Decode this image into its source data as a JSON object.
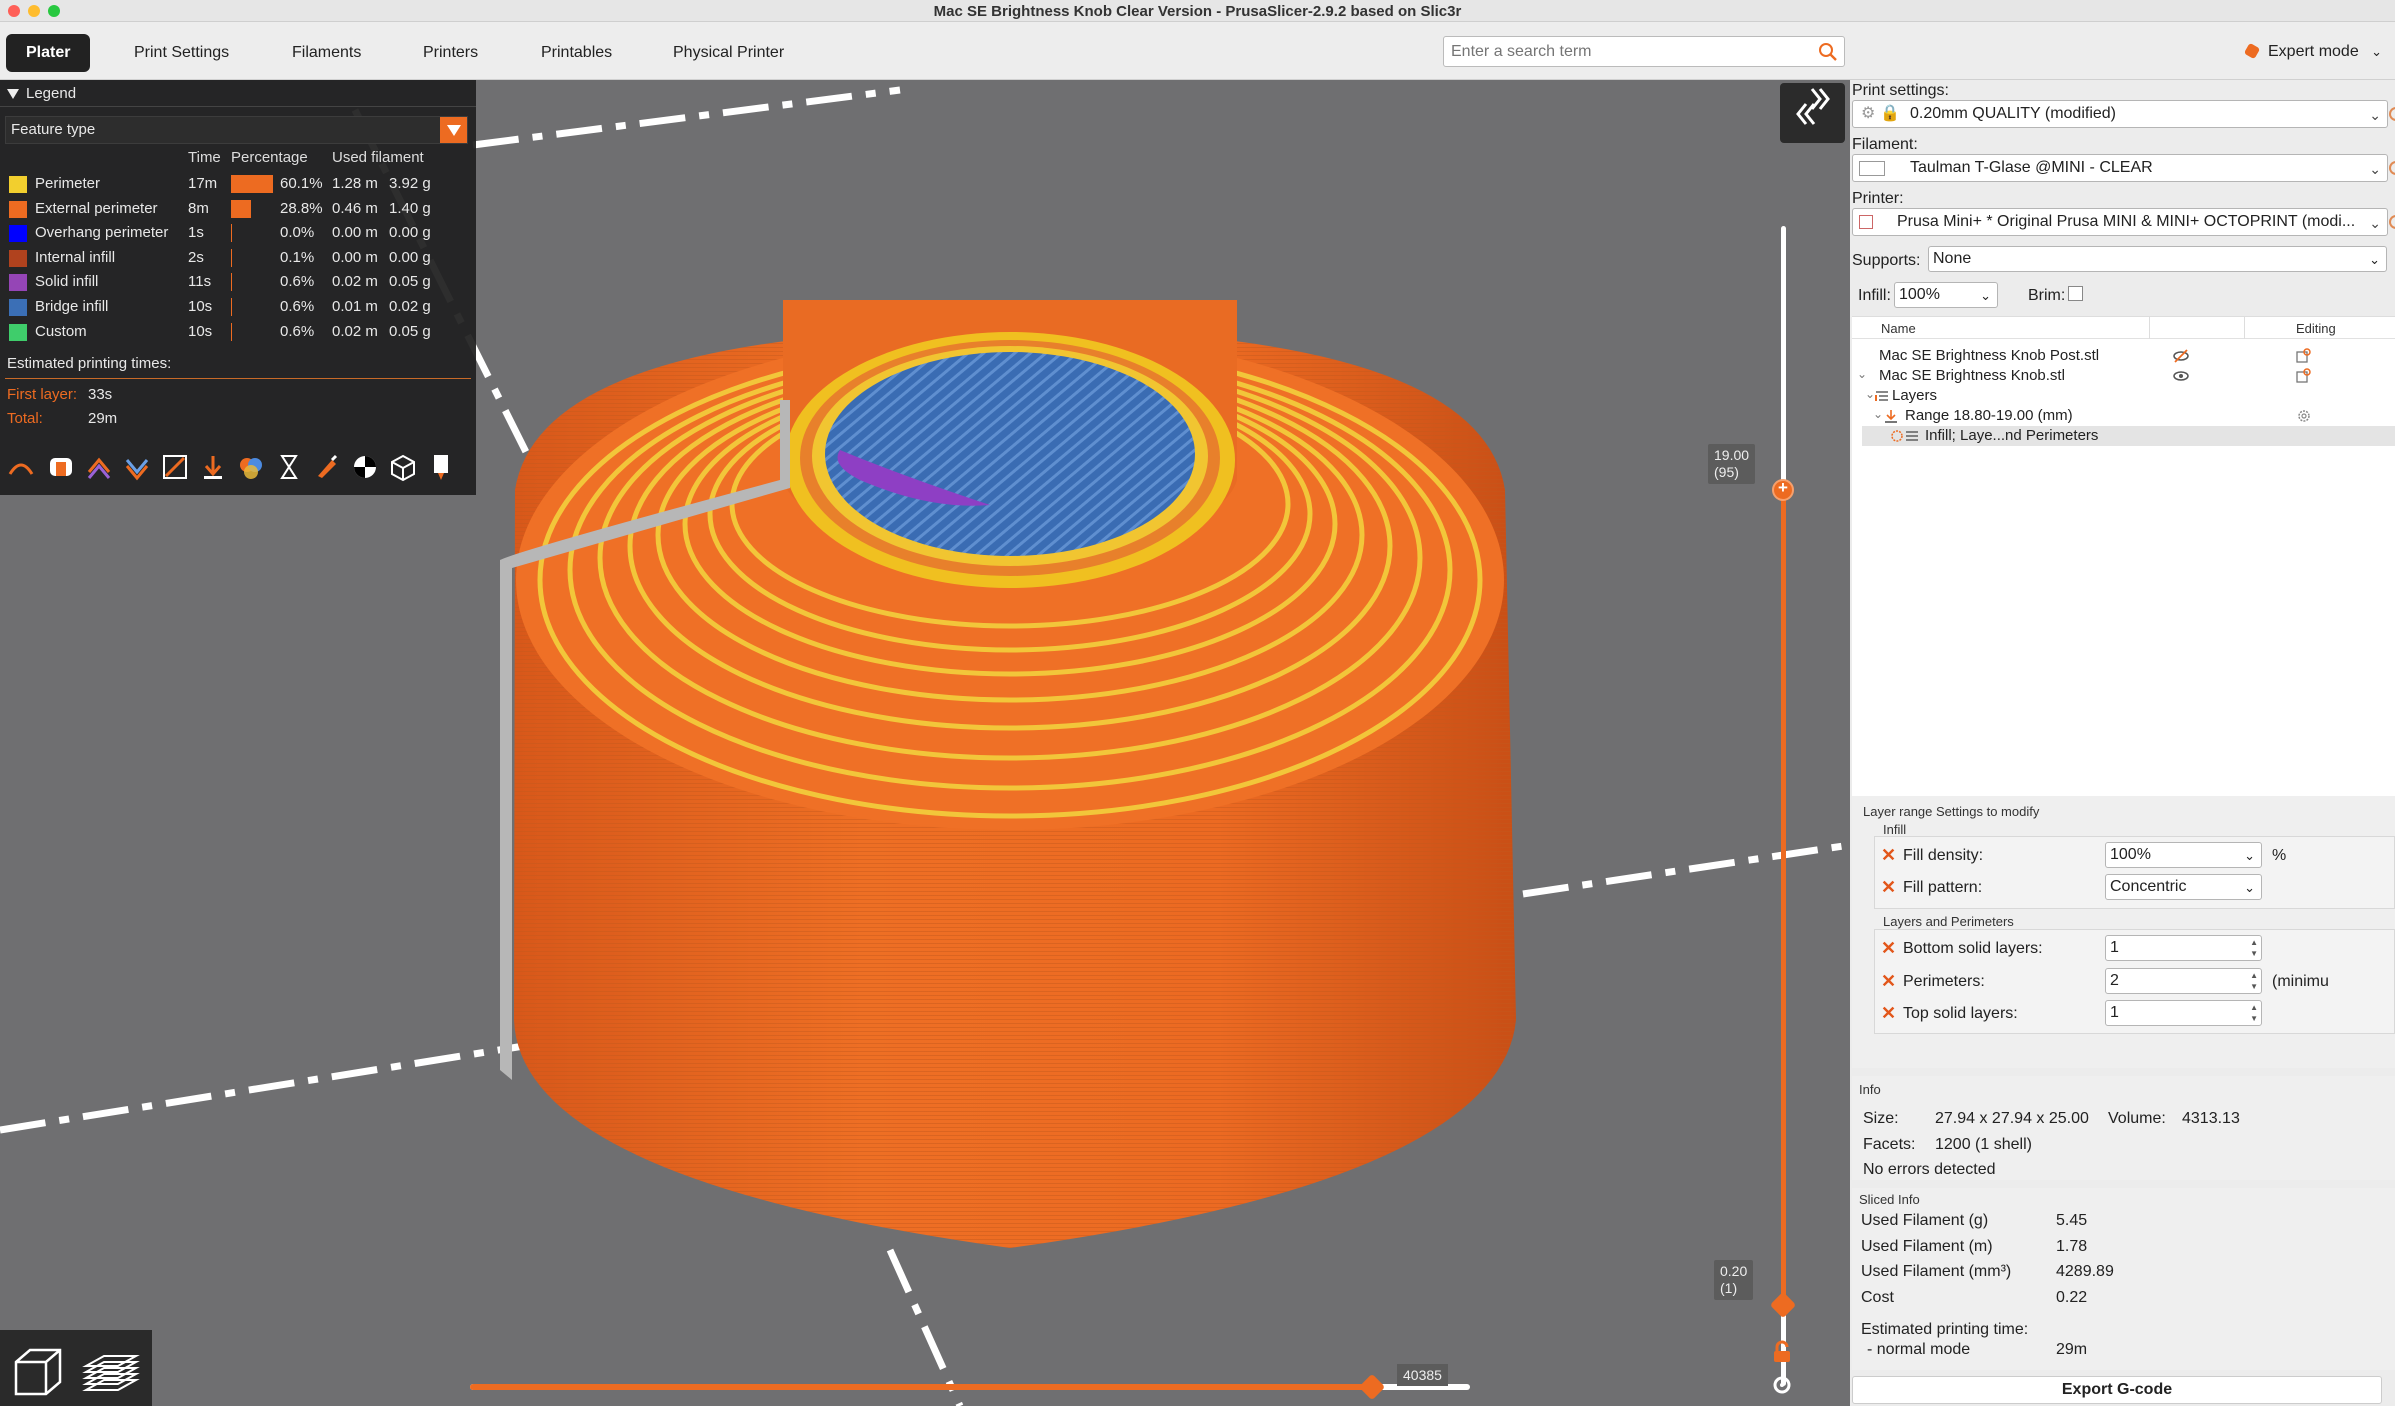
{
  "window": {
    "title": "Mac SE Brightness Knob Clear Version - PrusaSlicer-2.9.2 based on Slic3r"
  },
  "tabs": [
    {
      "label": "Plater"
    },
    {
      "label": "Print Settings"
    },
    {
      "label": "Filaments"
    },
    {
      "label": "Printers"
    },
    {
      "label": "Printables"
    },
    {
      "label": "Physical Printer"
    }
  ],
  "search": {
    "placeholder": "Enter a search term"
  },
  "mode": {
    "label": "Expert mode"
  },
  "legend": {
    "title": "Legend",
    "view_type": "Feature type",
    "headers": {
      "time": "Time",
      "percentage": "Percentage",
      "used_filament": "Used filament"
    },
    "rows": [
      {
        "name": "Perimeter",
        "time": "17m",
        "percent": "60.1%",
        "fraction": 0.601,
        "meters": "1.28 m",
        "grams": "3.92 g",
        "color": "#f2cf2e"
      },
      {
        "name": "External perimeter",
        "time": "8m",
        "percent": "28.8%",
        "fraction": 0.288,
        "meters": "0.46 m",
        "grams": "1.40 g",
        "color": "#ed6b21"
      },
      {
        "name": "Overhang perimeter",
        "time": "1s",
        "percent": "0.0%",
        "fraction": 0.0,
        "meters": "0.00 m",
        "grams": "0.00 g",
        "color": "#0000ff"
      },
      {
        "name": "Internal infill",
        "time": "2s",
        "percent": "0.1%",
        "fraction": 0.001,
        "meters": "0.00 m",
        "grams": "0.00 g",
        "color": "#b0421e"
      },
      {
        "name": "Solid infill",
        "time": "11s",
        "percent": "0.6%",
        "fraction": 0.006,
        "meters": "0.02 m",
        "grams": "0.05 g",
        "color": "#9545b6"
      },
      {
        "name": "Bridge infill",
        "time": "10s",
        "percent": "0.6%",
        "fraction": 0.006,
        "meters": "0.01 m",
        "grams": "0.02 g",
        "color": "#3b6fb6"
      },
      {
        "name": "Custom",
        "time": "10s",
        "percent": "0.6%",
        "fraction": 0.006,
        "meters": "0.02 m",
        "grams": "0.05 g",
        "color": "#3fcd6b"
      }
    ],
    "estimated_title": "Estimated printing times:",
    "first_layer_label": "First layer:",
    "first_layer_value": "33s",
    "total_label": "Total:",
    "total_value": "29m"
  },
  "vertical_slider": {
    "top_value": "19.00",
    "top_layer": "(95)",
    "bottom_value": "0.20",
    "bottom_layer": "(1)"
  },
  "horizontal_slider": {
    "value": "40385",
    "fraction": 0.902
  },
  "sidebar": {
    "print_settings_label": "Print settings:",
    "print_settings_value": "0.20mm QUALITY (modified)",
    "filament_label": "Filament:",
    "filament_value": "Taulman T-Glase @MINI - CLEAR",
    "printer_label": "Printer:",
    "printer_value": "Prusa Mini+ * Original Prusa MINI & MINI+ OCTOPRINT (modi...",
    "supports_label": "Supports:",
    "supports_value": "None",
    "infill_label": "Infill:",
    "infill_value": "100%",
    "brim_label": "Brim:",
    "brim_checked": false,
    "object_list": {
      "col_name": "Name",
      "col_editing": "Editing",
      "items": [
        {
          "label": "Mac SE Brightness Knob Post.stl"
        },
        {
          "label": "Mac SE Brightness Knob.stl"
        },
        {
          "label": "Layers"
        },
        {
          "label": "Range 18.80-19.00 (mm)"
        },
        {
          "label": "Infill; Laye...nd Perimeters"
        }
      ]
    },
    "layer_range": {
      "title": "Layer range Settings to modify",
      "infill_group": "Infill",
      "fill_density_label": "Fill density:",
      "fill_density_value": "100%",
      "fill_density_unit": "%",
      "fill_pattern_label": "Fill pattern:",
      "fill_pattern_value": "Concentric",
      "layers_group": "Layers and Perimeters",
      "bottom_solid_label": "Bottom solid layers:",
      "bottom_solid_value": "1",
      "perimeters_label": "Perimeters:",
      "perimeters_value": "2",
      "perimeters_unit": "(minimu",
      "top_solid_label": "Top solid layers:",
      "top_solid_value": "1"
    },
    "info": {
      "title": "Info",
      "size_label": "Size:",
      "size_value": "27.94 x 27.94 x 25.00",
      "volume_label": "Volume:",
      "volume_value": "4313.13",
      "facets_label": "Facets:",
      "facets_value": "1200 (1 shell)",
      "errors": "No errors detected"
    },
    "sliced": {
      "title": "Sliced Info",
      "rows": [
        {
          "label": "Used Filament (g)",
          "value": "5.45"
        },
        {
          "label": "Used Filament (m)",
          "value": "1.78"
        },
        {
          "label": "Used Filament (mm³)",
          "value": "4289.89"
        },
        {
          "label": "Cost",
          "value": "0.22"
        }
      ],
      "est_label": "Estimated printing time:",
      "mode_label": "- normal mode",
      "mode_value": "29m"
    },
    "export_label": "Export G-code"
  }
}
